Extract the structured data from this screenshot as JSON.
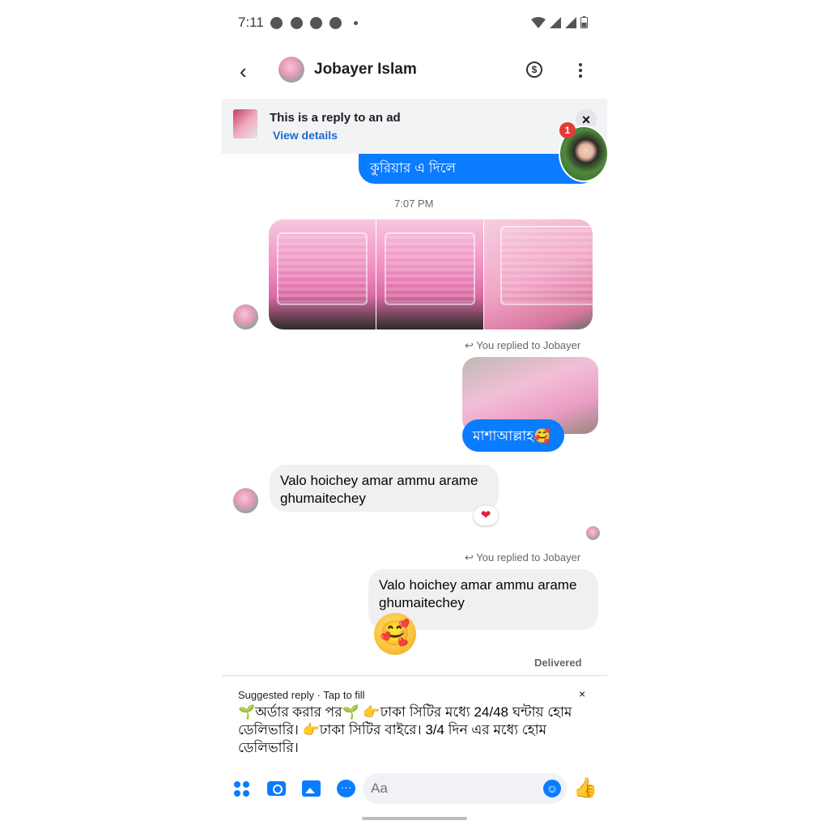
{
  "status_bar": {
    "time": "7:11"
  },
  "header": {
    "contact_name": "Jobayer Islam"
  },
  "ad_banner": {
    "title": "This is a reply to an ad",
    "link": "View details",
    "badge_count": "1"
  },
  "messages": {
    "courier_text": "কুরিয়ার এ দিলে",
    "timestamp": "7:07 PM",
    "reply_note_1": "You replied to Jobayer",
    "mashallah_text": "মাশাআল্লাহ🥰",
    "valo_incoming": "Valo hoichey amar ammu arame ghumaitechey",
    "reaction": "❤",
    "reply_note_2": "You replied to Jobayer",
    "valo_outgoing": "Valo hoichey amar ammu arame ghumaitechey",
    "emoji": "🥰",
    "delivered": "Delivered"
  },
  "suggested_reply": {
    "label": "Suggested reply · Tap to fill",
    "close": "×",
    "text": "🌱অর্ডার করার পর🌱 👉ঢাকা সিটির মধ্যে 24/48 ঘন্টায় হোম ডেলিভারি। 👉ঢাকা সিটির বাইরে। 3/4 দিন এর মধ্যে হোম ডেলিভারি।"
  },
  "composer": {
    "placeholder": "Aa"
  },
  "colors": {
    "accent": "#0a7cff",
    "bubble_gray": "#f0f0f2",
    "badge": "#e53935"
  }
}
